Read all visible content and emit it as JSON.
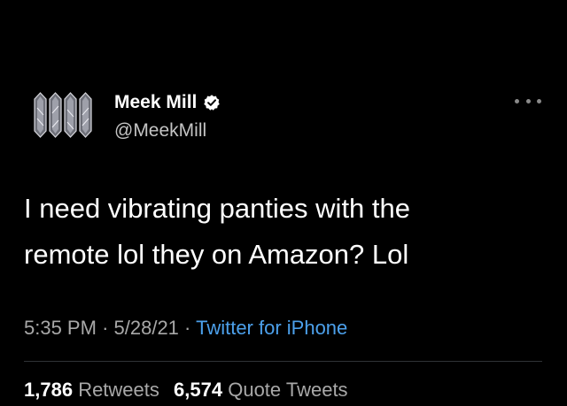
{
  "tweet": {
    "author": {
      "display_name": "Meek Mill",
      "handle": "@MeekMill",
      "verified": true
    },
    "text_lines": [
      "I need vibrating panties with the",
      "remote lol they on Amazon? Lol"
    ],
    "time": "5:35 PM",
    "separator": "·",
    "date": "5/28/21",
    "source": "Twitter for iPhone",
    "stats": {
      "retweets_count": "1,786",
      "retweets_label": "Retweets",
      "quotes_count": "6,574",
      "quotes_label": "Quote Tweets"
    }
  },
  "icons": {
    "avatar": "jeweled-chain-avatar",
    "verified": "verified-badge-icon",
    "more": "more-options-icon"
  },
  "colors": {
    "background": "#000000",
    "text_primary": "#ffffff",
    "text_secondary": "#a8a8a8",
    "link": "#4ca0eb",
    "divider": "#2f3336"
  }
}
